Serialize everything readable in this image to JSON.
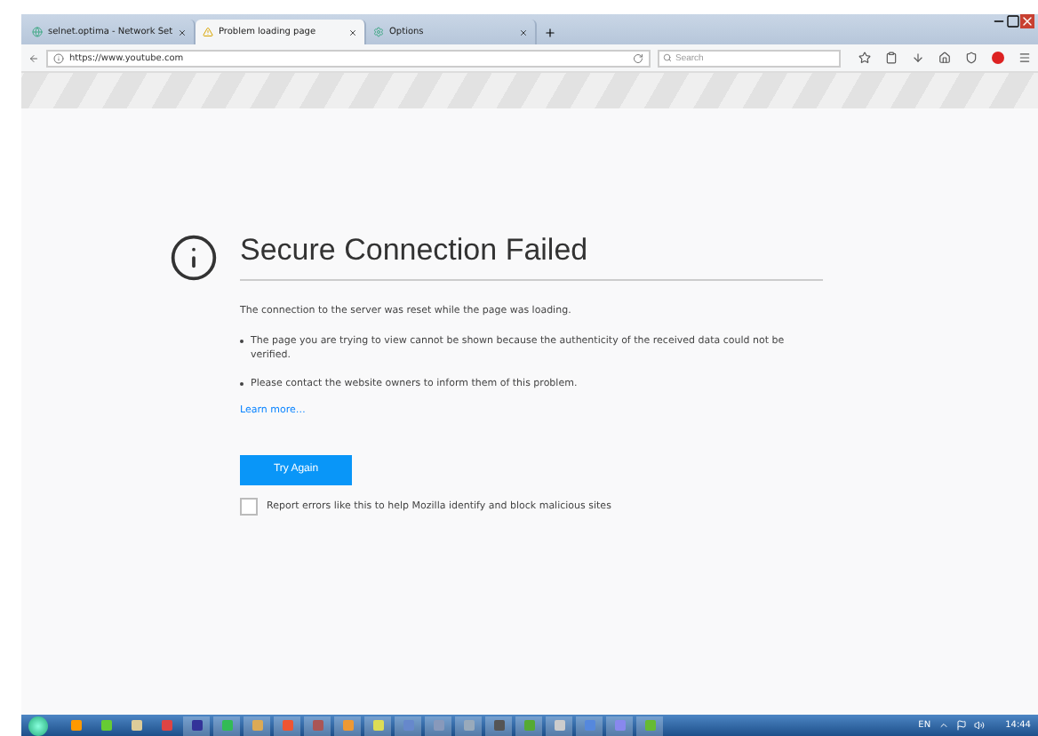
{
  "tabs": [
    {
      "label": "selnet.optima - Network Set",
      "kind": "globe",
      "selected": false
    },
    {
      "label": "Problem loading page",
      "kind": "warning",
      "selected": true
    },
    {
      "label": "Options",
      "kind": "gear",
      "selected": false
    }
  ],
  "address_bar": {
    "url": "https://www.youtube.com"
  },
  "search": {
    "placeholder": "Search"
  },
  "error": {
    "title": "Secure Connection Failed",
    "description": "The connection to the server was reset while the page was loading.",
    "bullets": [
      "The page you are trying to view cannot be shown because the authenticity of the received data could not be verified.",
      "Please contact the website owners to inform them of this problem."
    ],
    "learn_more": "Learn more…",
    "button": "Try Again",
    "report": {
      "label": "Report errors like this to help Mozilla identify and block malicious sites",
      "checked": false
    }
  },
  "taskbar": {
    "language": "EN",
    "clock": "14:44"
  }
}
